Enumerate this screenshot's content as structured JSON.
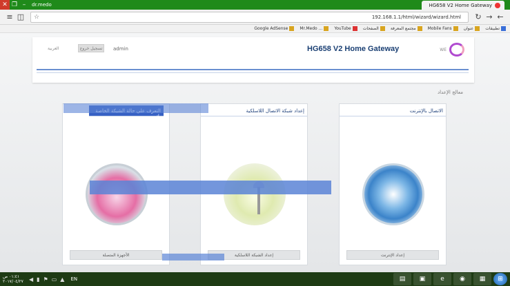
{
  "titlebar": {
    "user": "dr.medo",
    "tab_title": "HG658 V2 Home Gateway"
  },
  "toolbar": {
    "url": "192.168.1.1/html/wizard/wizard.html",
    "star_icon": "star-icon"
  },
  "bookmarks": {
    "apps_label": "تطبيقات",
    "items": [
      "Google AdSense",
      "Mr.Medo ...",
      "YouTube",
      "الصفحات",
      "مجتمع المعرفة",
      "Mobile Fans",
      "عنوان"
    ]
  },
  "header": {
    "title": "HG658 V2 Home Gateway",
    "user": "admin",
    "logout": "تسجيل خروج",
    "back": "العربية",
    "logo_text": "WE"
  },
  "wizard_label": "معالج الإعداد",
  "cards": {
    "status": {
      "title": "التعرف على حالة الشبكة الخاصة بك",
      "button": "الأجهزة المتصلة"
    },
    "wlan": {
      "title": "إعداد شبكة الاتصال اللاسلكية",
      "button": "إعداد الشبكة اللاسلكية"
    },
    "internet": {
      "title": "الاتصال بالإنترنت",
      "button": "إعداد الإنترنت"
    }
  },
  "taskbar": {
    "time": "٠١:٤١ ص",
    "date": "٢٠١٧/٠٤/٢٧",
    "lang": "EN"
  },
  "colors": {
    "accent": "#3761c4",
    "titlebar": "#1f8a1a",
    "taskbar": "#1e3b14"
  }
}
